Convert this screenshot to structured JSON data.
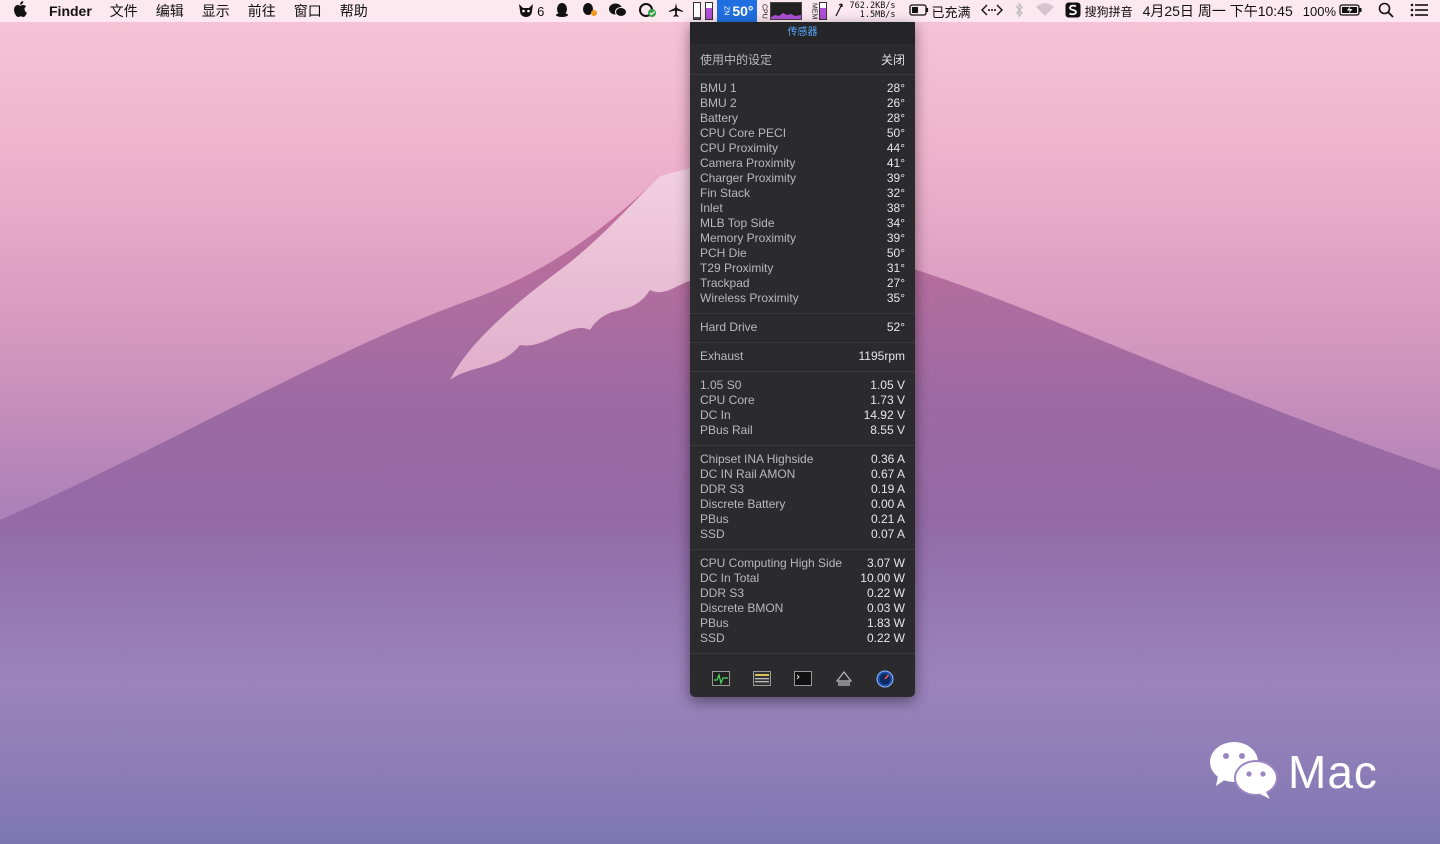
{
  "menubar": {
    "app_name": "Finder",
    "menus": [
      "文件",
      "编辑",
      "显示",
      "前往",
      "窗口",
      "帮助"
    ],
    "status": {
      "badge_count": "6",
      "temperature": "50°",
      "temp_tiny": "ZN",
      "net_up": "762.2KB/s",
      "net_down": "1.5MB/s",
      "charge_status": "已充满",
      "input_method": "搜狗拼音",
      "datetime": "4月25日 周一 下午10:45",
      "battery_percent": "100%",
      "memory_fill": 0.7
    }
  },
  "panel": {
    "title": "传感器",
    "header_label": "使用中的设定",
    "close_label": "关闭",
    "groups": [
      [
        {
          "name": "BMU 1",
          "value": "28°"
        },
        {
          "name": "BMU 2",
          "value": "26°"
        },
        {
          "name": "Battery",
          "value": "28°"
        },
        {
          "name": "CPU Core PECI",
          "value": "50°"
        },
        {
          "name": "CPU Proximity",
          "value": "44°"
        },
        {
          "name": "Camera Proximity",
          "value": "41°"
        },
        {
          "name": "Charger Proximity",
          "value": "39°"
        },
        {
          "name": "Fin Stack",
          "value": "32°"
        },
        {
          "name": "Inlet",
          "value": "38°"
        },
        {
          "name": "MLB Top Side",
          "value": "34°"
        },
        {
          "name": "Memory Proximity",
          "value": "39°"
        },
        {
          "name": "PCH Die",
          "value": "50°"
        },
        {
          "name": "T29 Proximity",
          "value": "31°"
        },
        {
          "name": "Trackpad",
          "value": "27°"
        },
        {
          "name": "Wireless Proximity",
          "value": "35°"
        }
      ],
      [
        {
          "name": "Hard Drive",
          "value": "52°"
        }
      ],
      [
        {
          "name": "Exhaust",
          "value": "1195rpm"
        }
      ],
      [
        {
          "name": "1.05 S0",
          "value": "1.05 V"
        },
        {
          "name": "CPU Core",
          "value": "1.73 V"
        },
        {
          "name": "DC In",
          "value": "14.92 V"
        },
        {
          "name": "PBus Rail",
          "value": "8.55 V"
        }
      ],
      [
        {
          "name": "Chipset INA Highside",
          "value": "0.36 A"
        },
        {
          "name": "DC IN Rail AMON",
          "value": "0.67 A"
        },
        {
          "name": "DDR S3",
          "value": "0.19 A"
        },
        {
          "name": "Discrete Battery",
          "value": "0.00 A"
        },
        {
          "name": "PBus",
          "value": "0.21 A"
        },
        {
          "name": "SSD",
          "value": "0.07 A"
        }
      ],
      [
        {
          "name": "CPU Computing High Side",
          "value": "3.07 W"
        },
        {
          "name": "DC In Total",
          "value": "10.00 W"
        },
        {
          "name": "DDR S3",
          "value": "0.22 W"
        },
        {
          "name": "Discrete BMON",
          "value": "0.03 W"
        },
        {
          "name": "PBus",
          "value": "1.83 W"
        },
        {
          "name": "SSD",
          "value": "0.22 W"
        }
      ]
    ],
    "footer_icons": [
      "activity-monitor-icon",
      "console-log-icon",
      "terminal-icon",
      "disk-utility-icon",
      "istat-gauge-icon"
    ]
  },
  "watermark": {
    "text": "Mac"
  },
  "colors": {
    "accent": "#1f6fe0",
    "panel_bg": "#2b2b2d",
    "panel_title": "#5aa6ff"
  }
}
